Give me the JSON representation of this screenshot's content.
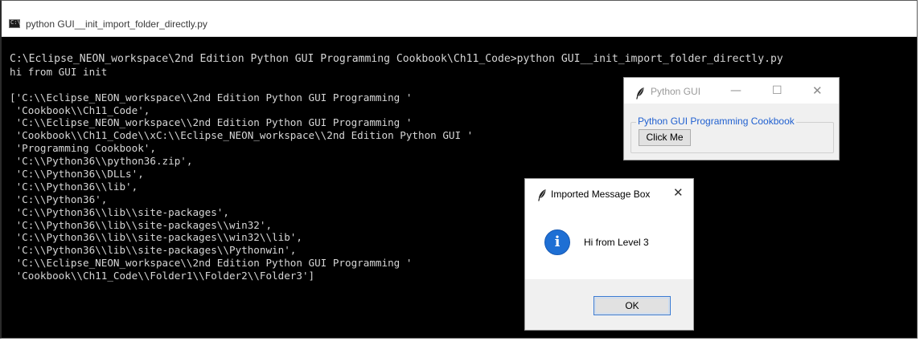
{
  "console": {
    "title": "python  GUI__init_import_folder_directly.py",
    "lines": [
      "C:\\Eclipse_NEON_workspace\\2nd Edition Python GUI Programming Cookbook\\Ch11_Code>python GUI__init_import_folder_directly.py",
      "hi from GUI init",
      "",
      "['C:\\\\Eclipse_NEON_workspace\\\\2nd Edition Python GUI Programming '",
      " 'Cookbook\\\\Ch11_Code',",
      " 'C:\\\\Eclipse_NEON_workspace\\\\2nd Edition Python GUI Programming '",
      " 'Cookbook\\\\Ch11_Code\\\\xC:\\\\Eclipse_NEON_workspace\\\\2nd Edition Python GUI '",
      " 'Programming Cookbook',",
      " 'C:\\\\Python36\\\\python36.zip',",
      " 'C:\\\\Python36\\\\DLLs',",
      " 'C:\\\\Python36\\\\lib',",
      " 'C:\\\\Python36',",
      " 'C:\\\\Python36\\\\lib\\\\site-packages',",
      " 'C:\\\\Python36\\\\lib\\\\site-packages\\\\win32',",
      " 'C:\\\\Python36\\\\lib\\\\site-packages\\\\win32\\\\lib',",
      " 'C:\\\\Python36\\\\lib\\\\site-packages\\\\Pythonwin',",
      " 'C:\\\\Eclipse_NEON_workspace\\\\2nd Edition Python GUI Programming '",
      " 'Cookbook\\\\Ch11_Code\\\\Folder1\\\\Folder2\\\\Folder3']"
    ]
  },
  "python_gui": {
    "title": "Python GUI",
    "minimize": "—",
    "maximize": "☐",
    "close": "✕",
    "frame_label": "Python GUI Programming Cookbook",
    "button_label": "Click Me"
  },
  "message_box": {
    "title": "Imported Message Box",
    "close": "✕",
    "icon_glyph": "i",
    "message": "Hi from Level 3",
    "ok_label": "OK"
  },
  "colors": {
    "console_bg": "#000000",
    "console_text": "#d6d6d6",
    "frame_label": "#2060d0",
    "info_icon": "#1e6fd4"
  },
  "icons": [
    "console-app-icon",
    "tk-feather-icon",
    "info-icon",
    "close-icon",
    "minimize-icon",
    "maximize-icon"
  ]
}
